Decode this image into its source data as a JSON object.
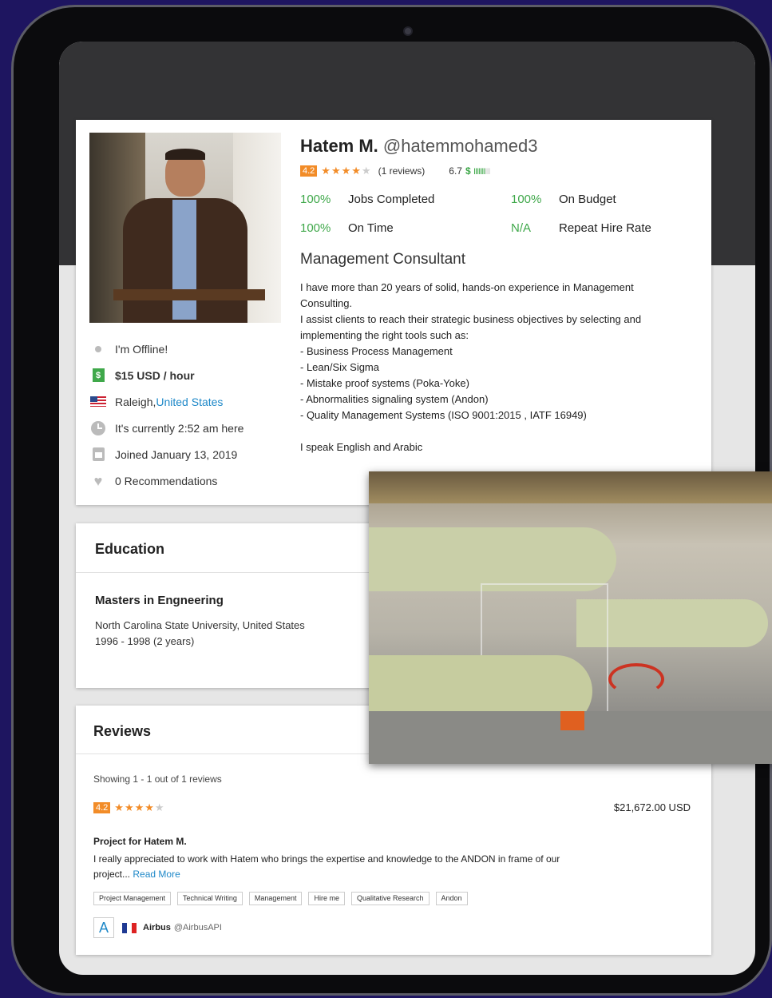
{
  "profile": {
    "name": "Hatem M.",
    "handle": "@hatemmohamed3",
    "rating": "4.2",
    "reviews_count": "(1 reviews)",
    "earnings_score": "6.7",
    "earnings_symbol": "$",
    "stats": [
      {
        "value": "100%",
        "label": "Jobs Completed"
      },
      {
        "value": "100%",
        "label": "On Budget"
      },
      {
        "value": "100%",
        "label": "On Time"
      },
      {
        "value": "N/A",
        "label": "Repeat Hire Rate"
      }
    ],
    "headline": "Management Consultant",
    "description": [
      "I have more than 20 years of solid, hands-on experience in Management Consulting.",
      "I assist clients to reach their strategic business objectives by selecting and implementing the right tools such as:",
      "- Business Process Management",
      "- Lean/Six Sigma",
      "- Mistake proof systems (Poka-Yoke)",
      "- Abnormalities signaling system (Andon)",
      "- Quality Management Systems (ISO 9001:2015 , IATF 16949)",
      "",
      "I speak English and Arabic"
    ]
  },
  "sidebar": {
    "status": "I'm Offline!",
    "rate": "$15 USD / hour",
    "city": "Raleigh, ",
    "country": "United States",
    "local_time": "It's currently 2:52 am here",
    "joined": "Joined January 13, 2019",
    "recommendations": "0 Recommendations",
    "icons": [
      "offline-dot-icon",
      "dollar-icon",
      "us-flag-icon",
      "clock-icon",
      "calendar-icon",
      "heart-icon"
    ]
  },
  "education": {
    "heading": "Education",
    "degree": "Masters in Engneering",
    "university": "North Carolina State University,  United States",
    "years": "1996 - 1998  (2 years)"
  },
  "reviews": {
    "heading": "Reviews",
    "showing": "Showing 1 - 1 out of 1 reviews",
    "items": [
      {
        "rating": "4.2",
        "amount": "$21,672.00 USD",
        "project": "Project for Hatem M.",
        "text": "I really appreciated to work with Hatem who brings the expertise and knowledge to the ANDON in frame of our project...",
        "read_more": "Read More",
        "tags": [
          "Project Management",
          "Technical Writing",
          "Management",
          "Hire me",
          "Qualitative Research",
          "Andon"
        ],
        "author_initial": "A",
        "author_company": "Airbus",
        "author_handle": "@AirbusAPI"
      }
    ]
  },
  "colors": {
    "background": "#1e1560",
    "accent_green": "#3fa84a",
    "accent_orange": "#f28c28",
    "link_blue": "#1e88c8"
  }
}
